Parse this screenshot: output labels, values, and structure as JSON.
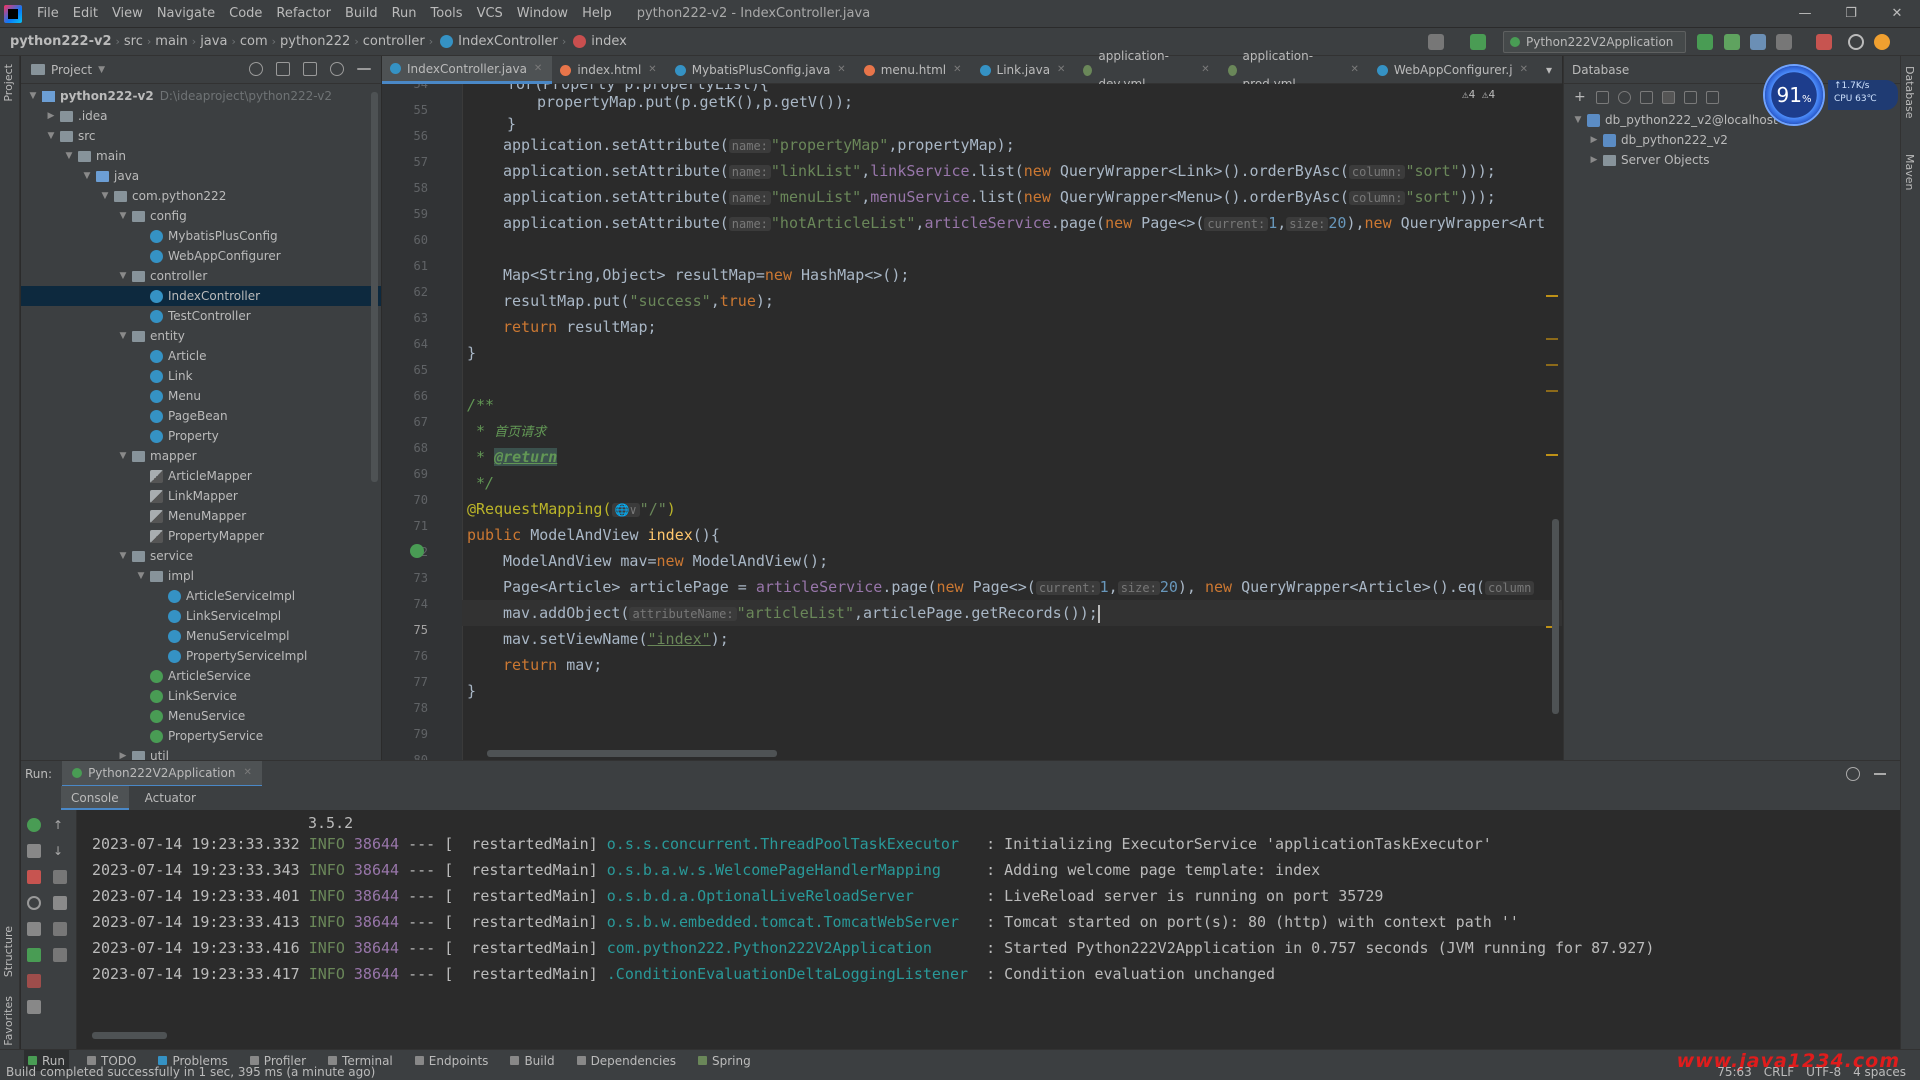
{
  "menubar": {
    "items": [
      "File",
      "Edit",
      "View",
      "Navigate",
      "Code",
      "Refactor",
      "Build",
      "Run",
      "Tools",
      "VCS",
      "Window",
      "Help"
    ],
    "title": "python222-v2 - IndexController.java"
  },
  "navbar": {
    "crumbs": [
      "python222-v2",
      "src",
      "main",
      "java",
      "com",
      "python222",
      "controller",
      "IndexController",
      "index"
    ],
    "run_config": "Python222V2Application"
  },
  "project": {
    "header": "Project",
    "tree": [
      {
        "label": "python222-v2",
        "path": "D:\\ideaproject\\python222-v2",
        "depth": 0,
        "arrow": "open",
        "icon": "module"
      },
      {
        "label": ".idea",
        "depth": 1,
        "arrow": "closed",
        "icon": "folder"
      },
      {
        "label": "src",
        "depth": 1,
        "arrow": "open",
        "icon": "folder"
      },
      {
        "label": "main",
        "depth": 2,
        "arrow": "open",
        "icon": "folder"
      },
      {
        "label": "java",
        "depth": 3,
        "arrow": "open",
        "icon": "folder-src"
      },
      {
        "label": "com.python222",
        "depth": 4,
        "arrow": "open",
        "icon": "folder"
      },
      {
        "label": "config",
        "depth": 5,
        "arrow": "open",
        "icon": "folder"
      },
      {
        "label": "MybatisPlusConfig",
        "depth": 6,
        "arrow": "",
        "icon": "class"
      },
      {
        "label": "WebAppConfigurer",
        "depth": 6,
        "arrow": "",
        "icon": "class"
      },
      {
        "label": "controller",
        "depth": 5,
        "arrow": "open",
        "icon": "folder"
      },
      {
        "label": "IndexController",
        "depth": 6,
        "arrow": "",
        "icon": "class",
        "selected": true
      },
      {
        "label": "TestController",
        "depth": 6,
        "arrow": "",
        "icon": "class"
      },
      {
        "label": "entity",
        "depth": 5,
        "arrow": "open",
        "icon": "folder"
      },
      {
        "label": "Article",
        "depth": 6,
        "arrow": "",
        "icon": "class"
      },
      {
        "label": "Link",
        "depth": 6,
        "arrow": "",
        "icon": "class"
      },
      {
        "label": "Menu",
        "depth": 6,
        "arrow": "",
        "icon": "class"
      },
      {
        "label": "PageBean",
        "depth": 6,
        "arrow": "",
        "icon": "class"
      },
      {
        "label": "Property",
        "depth": 6,
        "arrow": "",
        "icon": "class"
      },
      {
        "label": "mapper",
        "depth": 5,
        "arrow": "open",
        "icon": "folder"
      },
      {
        "label": "ArticleMapper",
        "depth": 6,
        "arrow": "",
        "icon": "mapper"
      },
      {
        "label": "LinkMapper",
        "depth": 6,
        "arrow": "",
        "icon": "mapper"
      },
      {
        "label": "MenuMapper",
        "depth": 6,
        "arrow": "",
        "icon": "mapper"
      },
      {
        "label": "PropertyMapper",
        "depth": 6,
        "arrow": "",
        "icon": "mapper"
      },
      {
        "label": "service",
        "depth": 5,
        "arrow": "open",
        "icon": "folder"
      },
      {
        "label": "impl",
        "depth": 6,
        "arrow": "open",
        "icon": "folder"
      },
      {
        "label": "ArticleServiceImpl",
        "depth": 7,
        "arrow": "",
        "icon": "class"
      },
      {
        "label": "LinkServiceImpl",
        "depth": 7,
        "arrow": "",
        "icon": "class"
      },
      {
        "label": "MenuServiceImpl",
        "depth": 7,
        "arrow": "",
        "icon": "class"
      },
      {
        "label": "PropertyServiceImpl",
        "depth": 7,
        "arrow": "",
        "icon": "class"
      },
      {
        "label": "ArticleService",
        "depth": 6,
        "arrow": "",
        "icon": "interface"
      },
      {
        "label": "LinkService",
        "depth": 6,
        "arrow": "",
        "icon": "interface"
      },
      {
        "label": "MenuService",
        "depth": 6,
        "arrow": "",
        "icon": "interface"
      },
      {
        "label": "PropertyService",
        "depth": 6,
        "arrow": "",
        "icon": "interface"
      },
      {
        "label": "util",
        "depth": 5,
        "arrow": "closed",
        "icon": "folder"
      }
    ]
  },
  "editor": {
    "tabs": [
      {
        "label": "IndexController.java",
        "active": true,
        "color": "#3592c4"
      },
      {
        "label": "index.html",
        "color": "#e8754a"
      },
      {
        "label": "MybatisPlusConfig.java",
        "color": "#3592c4"
      },
      {
        "label": "menu.html",
        "color": "#e8754a"
      },
      {
        "label": "Link.java",
        "color": "#3592c4"
      },
      {
        "label": "application-dev.yml",
        "color": "#6a8759"
      },
      {
        "label": "application-prod.yml",
        "color": "#6a8759"
      },
      {
        "label": "WebAppConfigurer.j",
        "color": "#3592c4"
      }
    ],
    "inspections": "⚠4  ⚠4",
    "line_numbers": [
      "54",
      "55",
      "56",
      "57",
      "58",
      "59",
      "60",
      "61",
      "62",
      "63",
      "64",
      "65",
      "66",
      "67",
      "68",
      "69",
      "70",
      "71",
      "72",
      "73",
      "74",
      "75",
      "76",
      "77",
      "78",
      "79",
      "80"
    ],
    "current_line": "75",
    "code": {
      "l54": "for(Property p:propertyList){",
      "l55a": "propertyMap.put(p.getK(),p.getV());",
      "l56": "}",
      "l57_call": "application.setAttribute(",
      "l57_hint": "name:",
      "l57_str": "\"propertyMap\"",
      "l57_rest": ",propertyMap);",
      "l58_call": "application.setAttribute(",
      "l58_hint": "name:",
      "l58_str": "\"linkList\"",
      "l58_mid": ",",
      "l58_fld": "linkService",
      "l58_rest1": ".list(",
      "l58_new": "new",
      "l58_rest2": " QueryWrapper<Link>().orderByAsc(",
      "l58_hint2": "column:",
      "l58_str2": "\"sort\"",
      "l58_end": ")));",
      "l59_call": "application.setAttribute(",
      "l59_hint": "name:",
      "l59_str": "\"menuList\"",
      "l59_mid": ",",
      "l59_fld": "menuService",
      "l59_rest1": ".list(",
      "l59_new": "new",
      "l59_rest2": " QueryWrapper<Menu>().orderByAsc(",
      "l59_hint2": "column:",
      "l59_str2": "\"sort\"",
      "l59_end": ")));",
      "l60_call": "application.setAttribute(",
      "l60_hint": "name:",
      "l60_str": "\"hotArticleList\"",
      "l60_mid": ",",
      "l60_fld": "articleService",
      "l60_rest1": ".page(",
      "l60_new": "new",
      "l60_rest2": " Page<>(",
      "l60_hint2": "current:",
      "l60_num1": "1",
      "l60_sep": ",",
      "l60_hint3": "size:",
      "l60_num2": "20",
      "l60_rest3": "),",
      "l60_new2": "new",
      "l60_rest4": " QueryWrapper<Art",
      "l62a": "Map<String,Object> resultMap=",
      "l62_new": "new",
      "l62b": " HashMap<>();",
      "l63a": "resultMap.put(",
      "l63_str": "\"success\"",
      "l63_sep": ",",
      "l63_kw": "true",
      "l63b": ");",
      "l64_kw": "return",
      "l64b": " resultMap;",
      "l65": "}",
      "l67": "/**",
      "l68a": "* ",
      "l68b": "首页请求",
      "l69a": "* ",
      "l69_tag": "@return",
      "l70": "*/",
      "l71_ann": "@RequestMapping(",
      "l71_glob": "🌐∨",
      "l71_str": "\"/\"",
      "l71_end": ")",
      "l72_kw": "public",
      "l72a": " ModelAndView ",
      "l72_fn": "index",
      "l72b": "(){",
      "l73a": "ModelAndView mav=",
      "l73_new": "new",
      "l73b": " ModelAndView();",
      "l74a": "Page<Article> articlePage = ",
      "l74_fld": "articleService",
      "l74b": ".page(",
      "l74_new": "new",
      "l74c": " Page<>(",
      "l74_hint1": "current:",
      "l74_num1": "1",
      "l74_sep": ",",
      "l74_hint2": "size:",
      "l74_num2": "20",
      "l74d": "), ",
      "l74_new2": "new",
      "l74e": " QueryWrapper<Article>().eq(",
      "l74_hint3": "column",
      "l75a": "mav.addObject(",
      "l75_hint": "attributeName:",
      "l75_str": "\"articleList\"",
      "l75b": ",articlePage.getRecords());",
      "l76a": "mav.setViewName(",
      "l76_link": "\"index\"",
      "l76b": ");",
      "l77_kw": "return",
      "l77b": " mav;",
      "l78": "}"
    }
  },
  "database": {
    "header": "Database",
    "items": [
      {
        "label": "db_python222_v2@localhost",
        "depth": 0,
        "arrow": "open",
        "icon": "db"
      },
      {
        "label": "db_python222_v2",
        "depth": 1,
        "arrow": "closed",
        "icon": "db"
      },
      {
        "label": "Server Objects",
        "depth": 1,
        "arrow": "closed",
        "icon": "folder"
      }
    ],
    "perf_value": "91",
    "perf_unit": "%",
    "perf_line1": "↑1.7K/s",
    "perf_line2": "CPU 63℃"
  },
  "run": {
    "label": "Run:",
    "tab": "Python222V2Application",
    "subtabs": [
      "Console",
      "Actuator"
    ],
    "banner": "3.5.2",
    "logs": [
      {
        "ts": "2023-07-14 19:23:33.332",
        "lvl": "INFO",
        "pid": "38644",
        "thread": " --- [  restartedMain] ",
        "logger": "o.s.s.concurrent.ThreadPoolTaskExecutor  ",
        "msg": " : Initializing ExecutorService 'applicationTaskExecutor'"
      },
      {
        "ts": "2023-07-14 19:23:33.343",
        "lvl": "INFO",
        "pid": "38644",
        "thread": " --- [  restartedMain] ",
        "logger": "o.s.b.a.w.s.WelcomePageHandlerMapping    ",
        "msg": " : Adding welcome page template: index"
      },
      {
        "ts": "2023-07-14 19:23:33.401",
        "lvl": "INFO",
        "pid": "38644",
        "thread": " --- [  restartedMain] ",
        "logger": "o.s.b.d.a.OptionalLiveReloadServer       ",
        "msg": " : LiveReload server is running on port 35729"
      },
      {
        "ts": "2023-07-14 19:23:33.413",
        "lvl": "INFO",
        "pid": "38644",
        "thread": " --- [  restartedMain] ",
        "logger": "o.s.b.w.embedded.tomcat.TomcatWebServer  ",
        "msg": " : Tomcat started on port(s): 80 (http) with context path ''"
      },
      {
        "ts": "2023-07-14 19:23:33.416",
        "lvl": "INFO",
        "pid": "38644",
        "thread": " --- [  restartedMain] ",
        "logger": "com.python222.Python222V2Application     ",
        "msg": " : Started Python222V2Application in 0.757 seconds (JVM running for 87.927)"
      },
      {
        "ts": "2023-07-14 19:23:33.417",
        "lvl": "INFO",
        "pid": "38644",
        "thread": " --- [  restartedMain] ",
        "logger": ".ConditionEvaluationDeltaLoggingListener ",
        "msg": " : Condition evaluation unchanged"
      }
    ]
  },
  "bottom_tools": [
    "Run",
    "TODO",
    "Problems",
    "Profiler",
    "Terminal",
    "Endpoints",
    "Build",
    "Dependencies",
    "Spring"
  ],
  "left_strip": [
    "Project",
    "Structure",
    "Favorites"
  ],
  "right_strip": [
    "Database",
    "Maven"
  ],
  "watermark": "www.java1234.com",
  "status": {
    "message": "Build completed successfully in 1 sec, 395 ms (a minute ago)",
    "position": "75:63",
    "line_sep": "CRLF",
    "encoding": "UTF-8",
    "indent": "4 spaces"
  }
}
